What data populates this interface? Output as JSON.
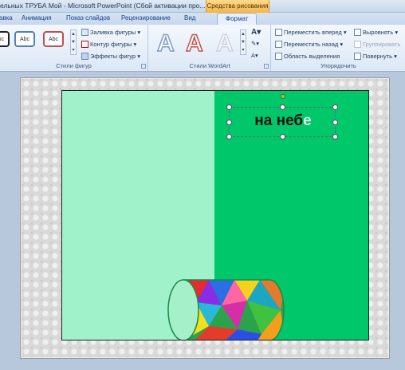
{
  "titlebar": {
    "title": "ельных ТРУБА Мой - Microsoft PowerPoint (Сбой активации про...",
    "context_tab": "Средства рисования"
  },
  "tabs": [
    {
      "label": "Вставка"
    },
    {
      "label": "Анимация"
    },
    {
      "label": "Показ слайдов"
    },
    {
      "label": "Рецензирование"
    },
    {
      "label": "Вид"
    },
    {
      "label": "Формат"
    }
  ],
  "ribbon": {
    "shape_styles": {
      "samples": [
        "Abc",
        "Abc",
        "Abc"
      ],
      "fill": "Заливка фигуры",
      "outline": "Контур фигуры",
      "effects": "Эффекты фигур",
      "label": "Стили фигур"
    },
    "wordart": {
      "samples": [
        "A",
        "A",
        "A"
      ],
      "label": "Стили WordArt"
    },
    "arrange": {
      "bring_forward": "Переместить вперед",
      "send_backward": "Переместить назад",
      "selection_pane": "Область выделения",
      "align": "Выровнять",
      "group": "Группировать",
      "rotate": "Повернуть",
      "label": "Упорядочить"
    }
  },
  "slide": {
    "textbox_text_main": "на неб",
    "textbox_text_last": "е",
    "left_color": "#9ff2c9",
    "right_color": "#00c76a"
  }
}
